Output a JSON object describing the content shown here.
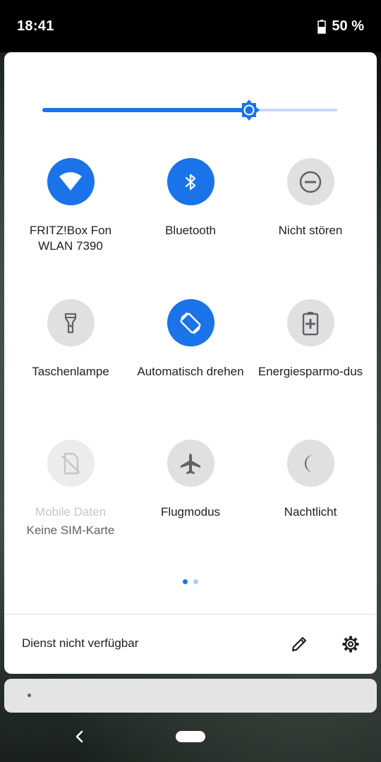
{
  "status_bar": {
    "time": "18:41",
    "battery": "50 %"
  },
  "brightness": {
    "level": 0.7
  },
  "tiles": [
    {
      "name": "wifi",
      "label": "FRITZ!Box Fon WLAN 7390",
      "state": "on",
      "icon": "wifi-icon"
    },
    {
      "name": "bluetooth",
      "label": "Bluetooth",
      "state": "on",
      "icon": "bluetooth-icon"
    },
    {
      "name": "dnd",
      "label": "Nicht stören",
      "state": "off",
      "icon": "do-not-disturb-icon"
    },
    {
      "name": "flashlight",
      "label": "Taschenlampe",
      "state": "off",
      "icon": "flashlight-icon"
    },
    {
      "name": "autorotate",
      "label": "Automatisch drehen",
      "state": "on",
      "icon": "auto-rotate-icon"
    },
    {
      "name": "battery-saver",
      "label": "Energiesparmo-dus",
      "state": "off",
      "icon": "battery-saver-icon"
    },
    {
      "name": "mobile-data",
      "label": "Mobile Daten",
      "sublabel": "Keine SIM-Karte",
      "state": "unavailable",
      "icon": "no-sim-icon"
    },
    {
      "name": "airplane",
      "label": "Flugmodus",
      "state": "off",
      "icon": "airplane-icon"
    },
    {
      "name": "night-light",
      "label": "Nachtlicht",
      "state": "off",
      "icon": "night-light-icon"
    }
  ],
  "pager": {
    "pages": 2,
    "current": 1
  },
  "footer": {
    "status_text": "Dienst nicht verfügbar",
    "edit_icon": "edit-icon",
    "settings_icon": "settings-icon"
  },
  "colors": {
    "accent": "#1a73e8",
    "tile_off": "#e0e0e0",
    "track_light": "#c5dafb"
  }
}
